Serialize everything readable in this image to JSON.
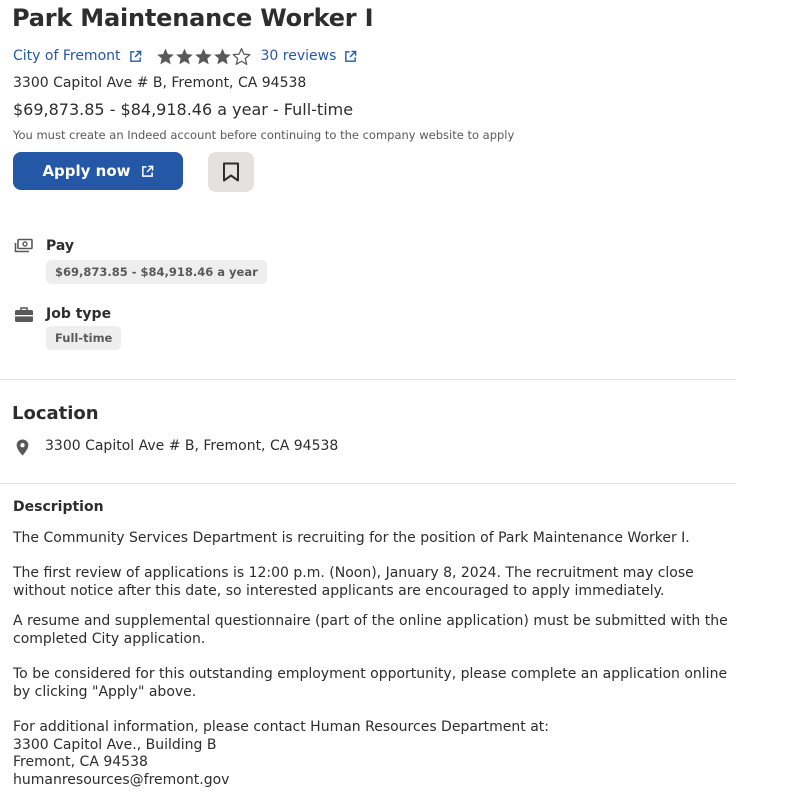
{
  "job": {
    "title": "Park Maintenance Worker I",
    "company": "City of Fremont",
    "rating": 4.5,
    "reviews_label": "30 reviews",
    "address": "3300 Capitol Ave # B, Fremont, CA 94538",
    "salary_line": "$69,873.85 - $84,918.46 a year  - Full-time",
    "account_notice": "You must create an Indeed account before continuing to the company website to apply"
  },
  "actions": {
    "apply_label": "Apply now"
  },
  "details": {
    "pay_label": "Pay",
    "pay_value": "$69,873.85 - $84,918.46 a year",
    "job_type_label": "Job type",
    "job_type_value": "Full-time"
  },
  "location": {
    "heading": "Location",
    "address": "3300 Capitol Ave # B, Fremont, CA 94538"
  },
  "description": {
    "heading": "Description",
    "p1": "The Community Services Department is recruiting for the position of Park Maintenance Worker I.",
    "p2": "The first review of applications is 12:00 p.m. (Noon), January 8, 2024. The recruitment may close without notice after this date, so interested applicants are encouraged to apply immediately.",
    "p3": "A resume and supplemental questionnaire (part of the online application) must be submitted with the completed City application.",
    "p4": "To be considered for this outstanding employment opportunity, please complete an application online by clicking \"Apply\" above.",
    "contact_intro": "For additional information, please contact Human Resources Department at:",
    "contact_street": "3300 Capitol Ave., Building B",
    "contact_city": "Fremont, CA 94538",
    "contact_email": "humanresources@fremont.gov"
  },
  "icons": {
    "external_link": "external-link-icon",
    "star": "star-icon",
    "bookmark": "bookmark-icon",
    "pay": "money-icon",
    "job_type": "briefcase-icon",
    "location": "map-pin-icon"
  },
  "colors": {
    "link": "#2557a7",
    "primary_button": "#2557a7",
    "text": "#2d2d2d",
    "muted": "#595959",
    "pill_bg": "#eeeeee",
    "save_bg": "#e4e2e0"
  }
}
